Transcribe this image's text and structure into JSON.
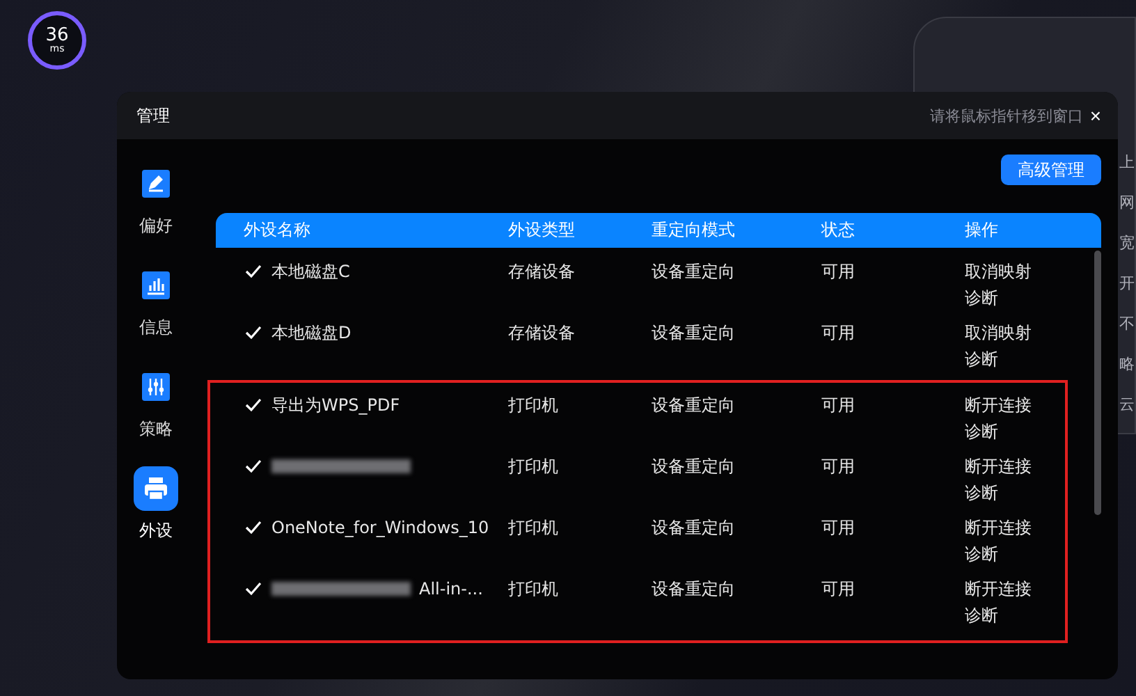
{
  "ping": {
    "value": "36",
    "unit": "ms"
  },
  "hint_panel": {
    "title_line": "请将鼠标指针移到窗口",
    "lines": [
      "上",
      "网",
      "宽",
      "开",
      "不",
      "略",
      "云"
    ]
  },
  "dialog": {
    "title": "管理",
    "close": "×"
  },
  "sidebar": {
    "items": [
      {
        "label": "偏好",
        "selected": false
      },
      {
        "label": "信息",
        "selected": false
      },
      {
        "label": "策略",
        "selected": false
      },
      {
        "label": "外设",
        "selected": true
      }
    ]
  },
  "advanced_button": "高级管理",
  "table": {
    "columns": [
      "外设名称",
      "外设类型",
      "重定向模式",
      "状态",
      "操作"
    ],
    "rows": [
      {
        "checked": true,
        "blurred": false,
        "name": "本地磁盘C",
        "type": "存储设备",
        "mode": "设备重定向",
        "status": "可用",
        "actions": [
          "取消映射",
          "诊断"
        ],
        "highlighted": false
      },
      {
        "checked": true,
        "blurred": false,
        "name": "本地磁盘D",
        "type": "存储设备",
        "mode": "设备重定向",
        "status": "可用",
        "actions": [
          "取消映射",
          "诊断"
        ],
        "highlighted": false
      },
      {
        "checked": true,
        "blurred": false,
        "name": "导出为WPS_PDF",
        "type": "打印机",
        "mode": "设备重定向",
        "status": "可用",
        "actions": [
          "断开连接",
          "诊断"
        ],
        "highlighted": true
      },
      {
        "checked": true,
        "blurred": true,
        "name": "",
        "type": "打印机",
        "mode": "设备重定向",
        "status": "可用",
        "actions": [
          "断开连接",
          "诊断"
        ],
        "highlighted": true
      },
      {
        "checked": true,
        "blurred": false,
        "name": "OneNote_for_Windows_10",
        "type": "打印机",
        "mode": "设备重定向",
        "status": "可用",
        "actions": [
          "断开连接",
          "诊断"
        ],
        "highlighted": true
      },
      {
        "checked": true,
        "blurred": true,
        "name": "All-in-...",
        "type": "打印机",
        "mode": "设备重定向",
        "status": "可用",
        "actions": [
          "断开连接",
          "诊断"
        ],
        "highlighted": true
      }
    ]
  }
}
